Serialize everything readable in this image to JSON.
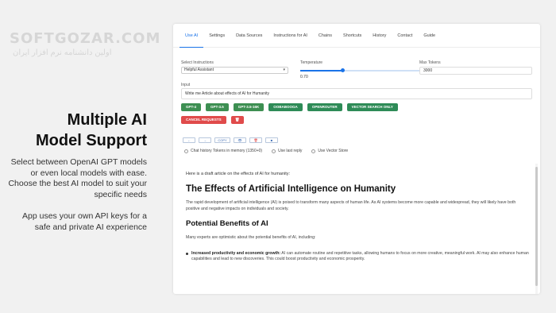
{
  "watermark": {
    "main": "SOFTGOZAR.COM",
    "sub": "اولین دانشنامه نرم افزار ایران"
  },
  "promo": {
    "title_line1": "Multiple AI",
    "title_line2": "Model Support",
    "text1": "Select between OpenAI GPT models or even local models with ease. Choose the best AI model to suit your specific needs",
    "text2": "App uses your own API keys for a safe and private AI experience"
  },
  "tabs": [
    "Use AI",
    "Settings",
    "Data Sources",
    "Instructions for AI",
    "Chains",
    "Shortcuts",
    "History",
    "Contact",
    "Guide"
  ],
  "controls": {
    "instructions_label": "Select Instructions",
    "instructions_value": "Helpful Assistant",
    "temperature_label": "Temperature",
    "temperature_value": "0.70",
    "temperature_fraction": 0.35,
    "max_tokens_label": "Max Tokens",
    "max_tokens_value": "3000"
  },
  "input": {
    "label": "Input",
    "value": "Write me Article about effects of AI for Humanity"
  },
  "model_buttons": [
    "GPT-4",
    "GPT-3.5",
    "GPT-3.5-16K",
    "OOBABOOGA",
    "OPENROUTER",
    "VECTOR SEARCH ONLY"
  ],
  "cancel_button": "CANCEL REQUESTS",
  "small_buttons": [
    "←",
    "→",
    "COPY",
    "👁",
    "🗑",
    "■"
  ],
  "checks": {
    "chat_history": "Chat history Tokens in memory (1350+0)",
    "use_last": "Use last reply",
    "vector_store": "Use Vector Store"
  },
  "output": {
    "intro": "Here is a draft article on the effects of AI for humanity:",
    "h1": "The Effects of Artificial Intelligence on Humanity",
    "p1": "The rapid development of artificial intelligence (AI) is poised to transform many aspects of human life. As AI systems become more capable and widespread, they will likely have both positive and negative impacts on individuals and society.",
    "h2": "Potential Benefits of AI",
    "p2": "Many experts are optimistic about the potential benefits of AI, including:",
    "li1_bold": "Increased productivity and economic growth:",
    "li1_text": " AI can automate routine and repetitive tasks, allowing humans to focus on more creative, meaningful work. AI may also enhance human capabilities and lead to new discoveries. This could boost productivity and economic prosperity."
  }
}
